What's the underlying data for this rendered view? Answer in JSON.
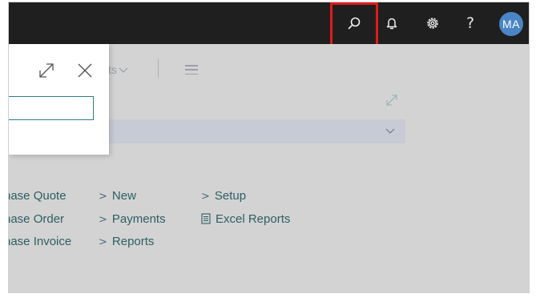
{
  "topbar": {
    "icons": [
      "search-icon",
      "bell-icon",
      "gear-icon",
      "help-icon"
    ],
    "help_label": "?",
    "avatar_initials": "MA",
    "highlight_color": "#e01b1b"
  },
  "page": {
    "actions_fragment": "ts",
    "links": {
      "col_a": [
        "hase Quote",
        "hase Order",
        "hase Invoice"
      ],
      "col_b": [
        "New",
        "Payments",
        "Reports"
      ],
      "col_c": [
        "Setup",
        "Excel Reports"
      ]
    }
  },
  "search_panel": {
    "input_value": "",
    "input_placeholder": ""
  },
  "colors": {
    "topbar": "#1f1f1f",
    "accent": "#2e7d83",
    "link": "#2d5f63",
    "avatar": "#4a86c5",
    "overlay": "#d3d3d3"
  }
}
